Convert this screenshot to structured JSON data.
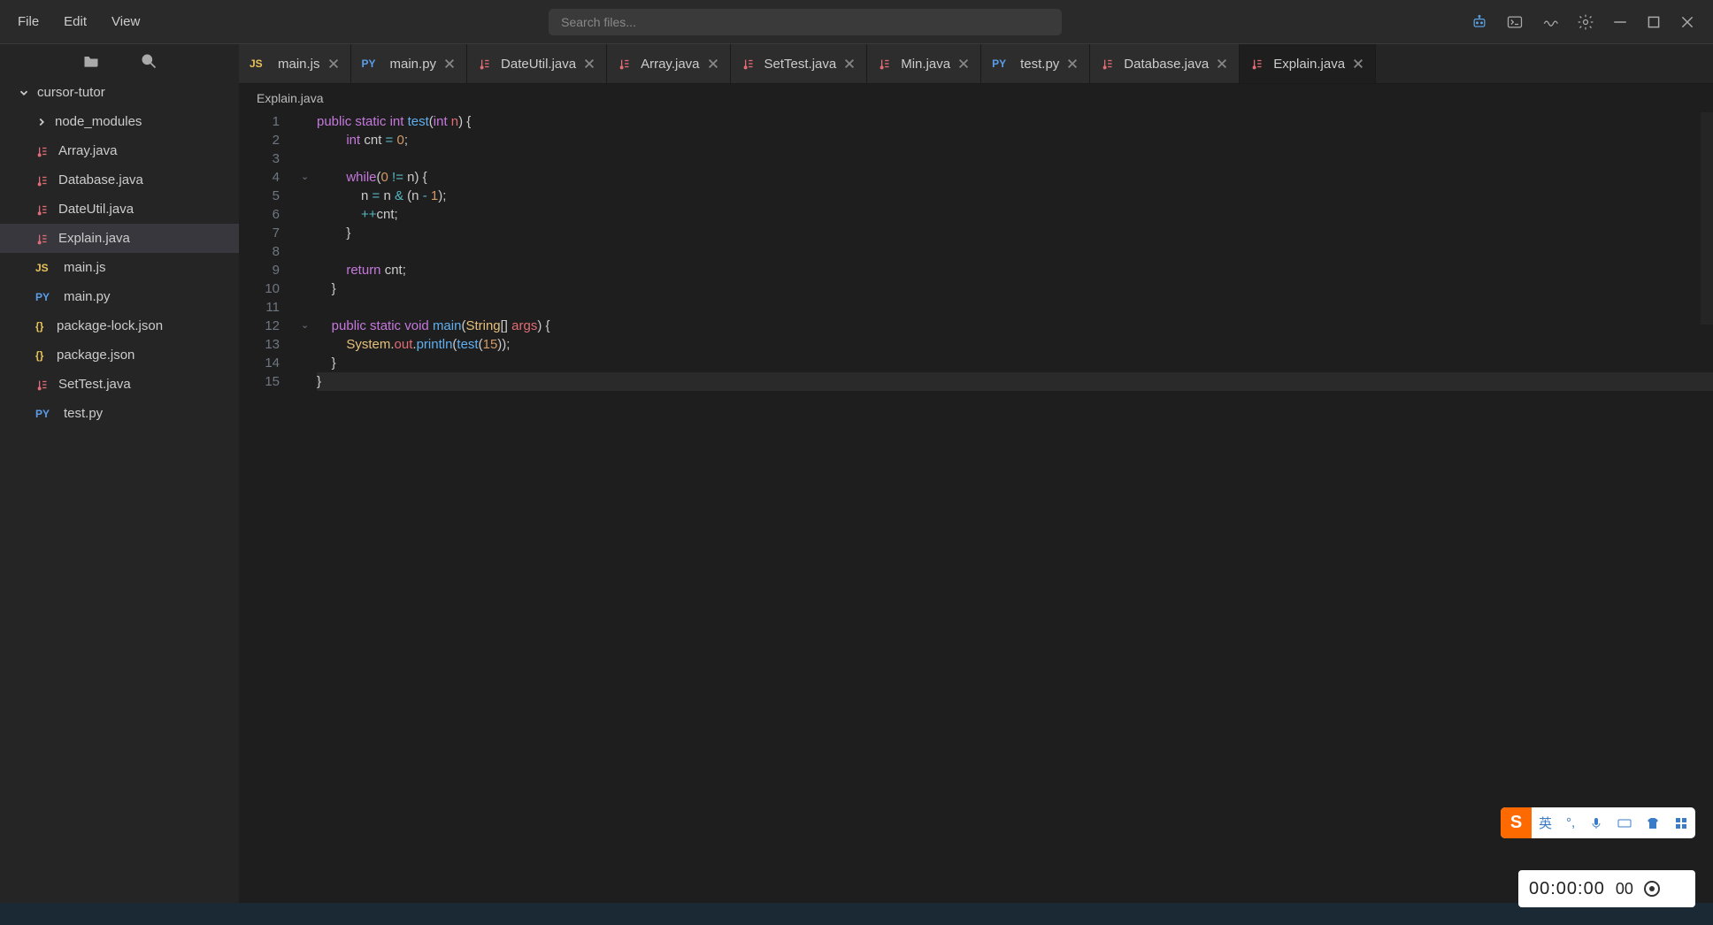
{
  "menu": {
    "file": "File",
    "edit": "Edit",
    "view": "View"
  },
  "search": {
    "placeholder": "Search files..."
  },
  "sidebar": {
    "root": "cursor-tutor",
    "folder": "node_modules",
    "files": [
      {
        "type": "java",
        "name": "Array.java"
      },
      {
        "type": "java",
        "name": "Database.java"
      },
      {
        "type": "java",
        "name": "DateUtil.java"
      },
      {
        "type": "java",
        "name": "Explain.java",
        "active": true
      },
      {
        "type": "js",
        "name": "main.js"
      },
      {
        "type": "py",
        "name": "main.py"
      },
      {
        "type": "json",
        "name": "package-lock.json"
      },
      {
        "type": "json",
        "name": "package.json"
      },
      {
        "type": "java",
        "name": "SetTest.java"
      },
      {
        "type": "py",
        "name": "test.py"
      }
    ]
  },
  "tabs": [
    {
      "type": "js",
      "name": "main.js"
    },
    {
      "type": "py",
      "name": "main.py"
    },
    {
      "type": "java",
      "name": "DateUtil.java"
    },
    {
      "type": "java",
      "name": "Array.java"
    },
    {
      "type": "java",
      "name": "SetTest.java"
    },
    {
      "type": "java",
      "name": "Min.java"
    },
    {
      "type": "py",
      "name": "test.py"
    },
    {
      "type": "java",
      "name": "Database.java"
    },
    {
      "type": "java",
      "name": "Explain.java",
      "active": true
    }
  ],
  "breadcrumb": "Explain.java",
  "ime": {
    "brand": "S",
    "lang": "英"
  },
  "timer": {
    "time": "00:00:00",
    "frames": "00"
  },
  "code": {
    "lines": 15,
    "fold_at": [
      4,
      12
    ],
    "tokens": [
      [
        [
          "kw",
          "public"
        ],
        [
          "plain",
          " "
        ],
        [
          "kw",
          "static"
        ],
        [
          "plain",
          " "
        ],
        [
          "type",
          "int"
        ],
        [
          "plain",
          " "
        ],
        [
          "method",
          "test"
        ],
        [
          "plain",
          "("
        ],
        [
          "type",
          "int"
        ],
        [
          "plain",
          " "
        ],
        [
          "var",
          "n"
        ],
        [
          "plain",
          ") {"
        ]
      ],
      [
        [
          "plain",
          "        "
        ],
        [
          "type",
          "int"
        ],
        [
          "plain",
          " cnt "
        ],
        [
          "op",
          "="
        ],
        [
          "plain",
          " "
        ],
        [
          "num",
          "0"
        ],
        [
          "plain",
          ";"
        ]
      ],
      [],
      [
        [
          "plain",
          "        "
        ],
        [
          "kw",
          "while"
        ],
        [
          "plain",
          "("
        ],
        [
          "num",
          "0"
        ],
        [
          "plain",
          " "
        ],
        [
          "op",
          "!="
        ],
        [
          "plain",
          " n) {"
        ]
      ],
      [
        [
          "plain",
          "            n "
        ],
        [
          "op",
          "="
        ],
        [
          "plain",
          " n "
        ],
        [
          "op",
          "&"
        ],
        [
          "plain",
          " (n "
        ],
        [
          "op",
          "-"
        ],
        [
          "plain",
          " "
        ],
        [
          "num",
          "1"
        ],
        [
          "plain",
          ");"
        ]
      ],
      [
        [
          "plain",
          "            "
        ],
        [
          "op",
          "++"
        ],
        [
          "plain",
          "cnt;"
        ]
      ],
      [
        [
          "plain",
          "        }"
        ]
      ],
      [],
      [
        [
          "plain",
          "        "
        ],
        [
          "kw",
          "return"
        ],
        [
          "plain",
          " cnt;"
        ]
      ],
      [
        [
          "plain",
          "    }"
        ]
      ],
      [],
      [
        [
          "plain",
          "    "
        ],
        [
          "kw",
          "public"
        ],
        [
          "plain",
          " "
        ],
        [
          "kw",
          "static"
        ],
        [
          "plain",
          " "
        ],
        [
          "type",
          "void"
        ],
        [
          "plain",
          " "
        ],
        [
          "method",
          "main"
        ],
        [
          "plain",
          "("
        ],
        [
          "cls",
          "String"
        ],
        [
          "plain",
          "[] "
        ],
        [
          "var",
          "args"
        ],
        [
          "plain",
          ") {"
        ]
      ],
      [
        [
          "plain",
          "        "
        ],
        [
          "cls",
          "System"
        ],
        [
          "plain",
          "."
        ],
        [
          "var",
          "out"
        ],
        [
          "plain",
          "."
        ],
        [
          "method",
          "println"
        ],
        [
          "plain",
          "("
        ],
        [
          "method",
          "test"
        ],
        [
          "plain",
          "("
        ],
        [
          "num",
          "15"
        ],
        [
          "plain",
          "));"
        ]
      ],
      [
        [
          "plain",
          "    }"
        ]
      ],
      [
        [
          "plain",
          "}"
        ]
      ]
    ]
  }
}
